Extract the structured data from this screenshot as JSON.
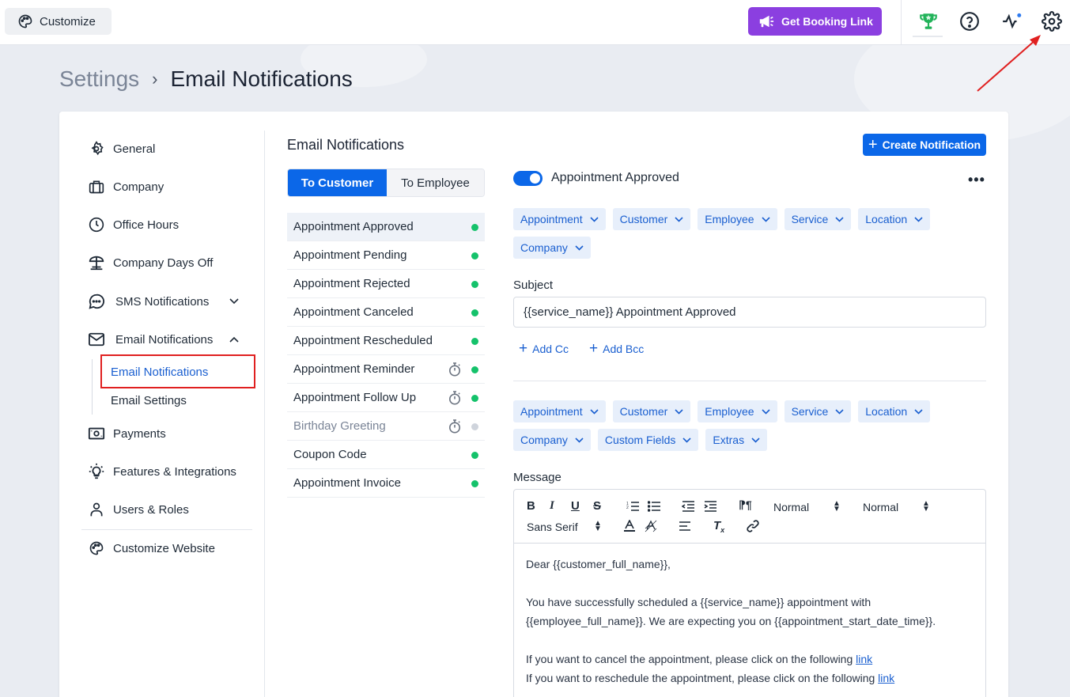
{
  "topbar": {
    "customize_label": "Customize",
    "booking_label": "Get Booking Link",
    "icons": [
      "trophy-icon",
      "help-icon",
      "activity-icon",
      "settings-icon"
    ]
  },
  "breadcrumb": {
    "parent": "Settings",
    "current": "Email Notifications"
  },
  "sidebar": {
    "items": [
      {
        "label": "General",
        "icon": "gear-icon"
      },
      {
        "label": "Company",
        "icon": "briefcase-icon"
      },
      {
        "label": "Office Hours",
        "icon": "clock-icon"
      },
      {
        "label": "Company Days Off",
        "icon": "beach-icon"
      },
      {
        "label": "SMS Notifications",
        "icon": "chat-icon"
      },
      {
        "label": "Email Notifications",
        "icon": "mail-icon"
      },
      {
        "label": "Payments",
        "icon": "money-icon"
      },
      {
        "label": "Features & Integrations",
        "icon": "bulb-icon"
      },
      {
        "label": "Users & Roles",
        "icon": "user-icon"
      },
      {
        "label": "Customize Website",
        "icon": "palette-icon"
      }
    ],
    "email_sub": [
      "Email Notifications",
      "Email Settings"
    ]
  },
  "main": {
    "title": "Email Notifications",
    "tabs": [
      "To Customer",
      "To Employee"
    ],
    "create_label": "Create Notification",
    "notifications": [
      {
        "name": "Appointment Approved",
        "timer": false,
        "enabled": true
      },
      {
        "name": "Appointment Pending",
        "timer": false,
        "enabled": true
      },
      {
        "name": "Appointment Rejected",
        "timer": false,
        "enabled": true
      },
      {
        "name": "Appointment Canceled",
        "timer": false,
        "enabled": true
      },
      {
        "name": "Appointment Rescheduled",
        "timer": false,
        "enabled": true
      },
      {
        "name": "Appointment Reminder",
        "timer": true,
        "enabled": true
      },
      {
        "name": "Appointment Follow Up",
        "timer": true,
        "enabled": true
      },
      {
        "name": "Birthday Greeting",
        "timer": true,
        "enabled": false
      },
      {
        "name": "Coupon Code",
        "timer": false,
        "enabled": true
      },
      {
        "name": "Appointment Invoice",
        "timer": false,
        "enabled": true
      }
    ],
    "selected_name": "Appointment Approved",
    "subject_tags": [
      "Appointment",
      "Customer",
      "Employee",
      "Service",
      "Location",
      "Company"
    ],
    "subject_label": "Subject",
    "subject_value": "{{service_name}} Appointment Approved",
    "add_cc": "Add Cc",
    "add_bcc": "Add Bcc",
    "message_tags": [
      "Appointment",
      "Customer",
      "Employee",
      "Service",
      "Location",
      "Company",
      "Custom Fields",
      "Extras"
    ],
    "message_label": "Message",
    "toolbar": {
      "size": "Normal",
      "heading": "Normal",
      "font": "Sans Serif"
    },
    "message": {
      "line1": "Dear {{customer_full_name}},",
      "line2": "You have successfully scheduled a {{service_name}} appointment with",
      "line3": "{{employee_full_name}}. We are expecting you on {{appointment_start_date_time}}.",
      "line4": "If you want to cancel the appointment, please click on the following ",
      "line5": "If you want to reschedule the appointment, please click on the following ",
      "link": "link"
    }
  },
  "colors": {
    "accent": "#0b67e8",
    "booking": "#8b3fe0",
    "status_on": "#15c26b",
    "annotation": "#e02020"
  }
}
